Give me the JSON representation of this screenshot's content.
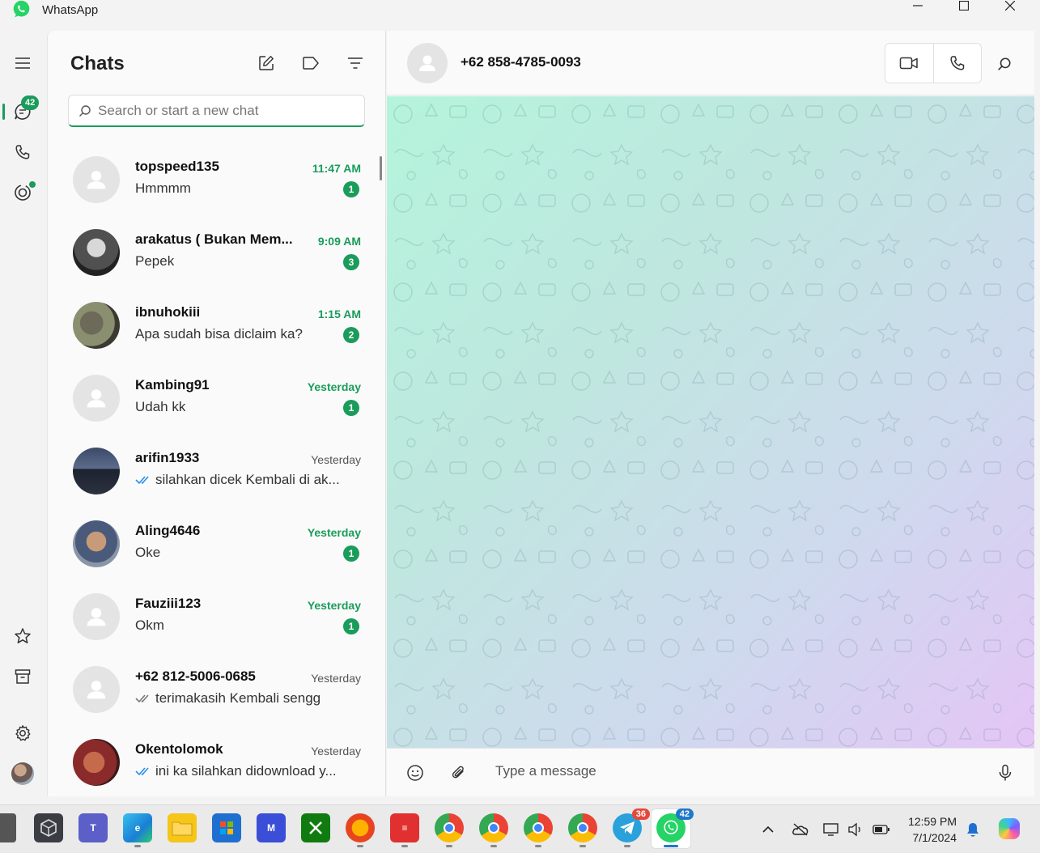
{
  "window": {
    "title": "WhatsApp",
    "controls": {
      "minimize": "minimize-icon",
      "maximize": "maximize-icon",
      "close": "close-icon"
    }
  },
  "colors": {
    "accent": "#1a9c5b",
    "badge_red": "#e5483b"
  },
  "rail": {
    "chats_badge": "42",
    "icons": [
      "menu-icon",
      "chats-icon",
      "calls-icon",
      "status-icon",
      "starred-icon",
      "archive-icon",
      "settings-icon",
      "profile-avatar"
    ]
  },
  "chat_list": {
    "title": "Chats",
    "search_placeholder": "Search or start a new chat",
    "chats": [
      {
        "name": "topspeed135",
        "message": "Hmmmm",
        "time": "11:47 AM",
        "unread": "1",
        "ticks": false,
        "photo": false
      },
      {
        "name": "arakatus ( Bukan Mem...",
        "message": "Pepek",
        "time": "9:09 AM",
        "unread": "3",
        "ticks": false,
        "photo": true
      },
      {
        "name": "ibnuhokiii",
        "message": "Apa sudah bisa diclaim ka?",
        "time": "1:15 AM",
        "unread": "2",
        "ticks": false,
        "photo": true
      },
      {
        "name": "Kambing91",
        "message": "Udah kk",
        "time": "Yesterday",
        "unread": "1",
        "ticks": false,
        "photo": false
      },
      {
        "name": "arifin1933",
        "message": "silahkan dicek Kembali di ak...",
        "time": "Yesterday",
        "unread": "",
        "ticks": "blue",
        "photo": true
      },
      {
        "name": "Aling4646",
        "message": "Oke",
        "time": "Yesterday",
        "unread": "1",
        "ticks": false,
        "photo": true
      },
      {
        "name": "Fauziii123",
        "message": "Okm",
        "time": "Yesterday",
        "unread": "1",
        "ticks": false,
        "photo": false
      },
      {
        "name": "+62 812-5006-0685",
        "message": "terimakasih Kembali sengg",
        "time": "Yesterday",
        "unread": "",
        "ticks": "gray",
        "photo": false
      },
      {
        "name": "Okentolomok",
        "message": "ini ka silahkan didownload y...",
        "time": "Yesterday",
        "unread": "",
        "ticks": "blue",
        "photo": true
      }
    ]
  },
  "conversation": {
    "contact_name": "+62 858-4785-0093",
    "composer_placeholder": "Type a message"
  },
  "taskbar": {
    "whatsapp_badge": "42",
    "telegram_badge": "36",
    "time": "12:59 PM",
    "date": "7/1/2024"
  }
}
